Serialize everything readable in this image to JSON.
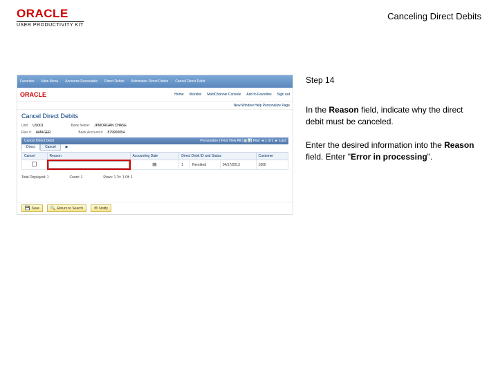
{
  "header": {
    "brand": "ORACLE",
    "product": "USER PRODUCTIVITY KIT",
    "title": "Canceling Direct Debits"
  },
  "instructions": {
    "step": "Step 14",
    "p1_before": "In the ",
    "p1_bold": "Reason",
    "p1_after": " field, indicate why the direct debit must be canceled.",
    "p2_a": "Enter the desired information into the ",
    "p2_bold1": "Reason",
    "p2_b": " field. Enter \"",
    "p2_bold2": "Error in processing",
    "p2_c": "\"."
  },
  "ps": {
    "breadcrumb": [
      "Favorites",
      "Main Menu",
      "Accounts Receivable",
      "Direct Debits",
      "Administer Direct Debits",
      "Cancel Direct Debit"
    ],
    "nav_right": [
      "Home",
      "Worklist",
      "MultiChannel Console",
      "Add to Favorites",
      "Sign out"
    ],
    "brand": "ORACLE",
    "top_tabs": [
      "Home",
      "Worklist",
      "MultiChannel Console",
      "Add to Favorites",
      "Sign out"
    ],
    "user_actions": "New Window  Help  Personalize Page",
    "page_title": "Cancel Direct Debits",
    "fields": {
      "unit_lbl": "Unit:",
      "unit_val": "US001",
      "bank_name_lbl": "Bank Name:",
      "bank_name_val": "JPMORGAN CHASE",
      "run_lbl": "Run #:",
      "run_val": "AMAGER",
      "bank_acct_lbl": "Bank Account #:",
      "bank_acct_val": "879900054"
    },
    "section_title": "Cancel Direct Debit",
    "grid_toolbar": "Personalize | Find   View All  | ▦  📊    First  ◄ 1 of 1 ►  Last",
    "subtabs": {
      "direct": "Direct",
      "cancel": "Cancel"
    },
    "expander": "▶",
    "columns": {
      "cancel": "Cancel",
      "reason": "Reason",
      "acct_date": "Accounting Date",
      "dd_id": "Direct Debit ID and Status",
      "dd_status": "",
      "cust": "Customer"
    },
    "row": {
      "cancel": "",
      "reason": "",
      "acct_date_btn": "🗓",
      "dd_id": "1",
      "dd_status": "Remitted",
      "dd_date": "04/17/2013",
      "cust": "1000"
    },
    "footer": {
      "total_lbl": "Total Displayed:",
      "total_val": "1",
      "count_lbl": "Count:",
      "count_val": "1",
      "rows_lbl": "Rows:",
      "rows_from": "1",
      "rows_to": "To:",
      "rows_to_val": "1",
      "of_lbl": "Of:",
      "of_val": "1"
    },
    "buttons": {
      "save": "Save",
      "return": "Return to Search",
      "notify": "Notify"
    }
  }
}
